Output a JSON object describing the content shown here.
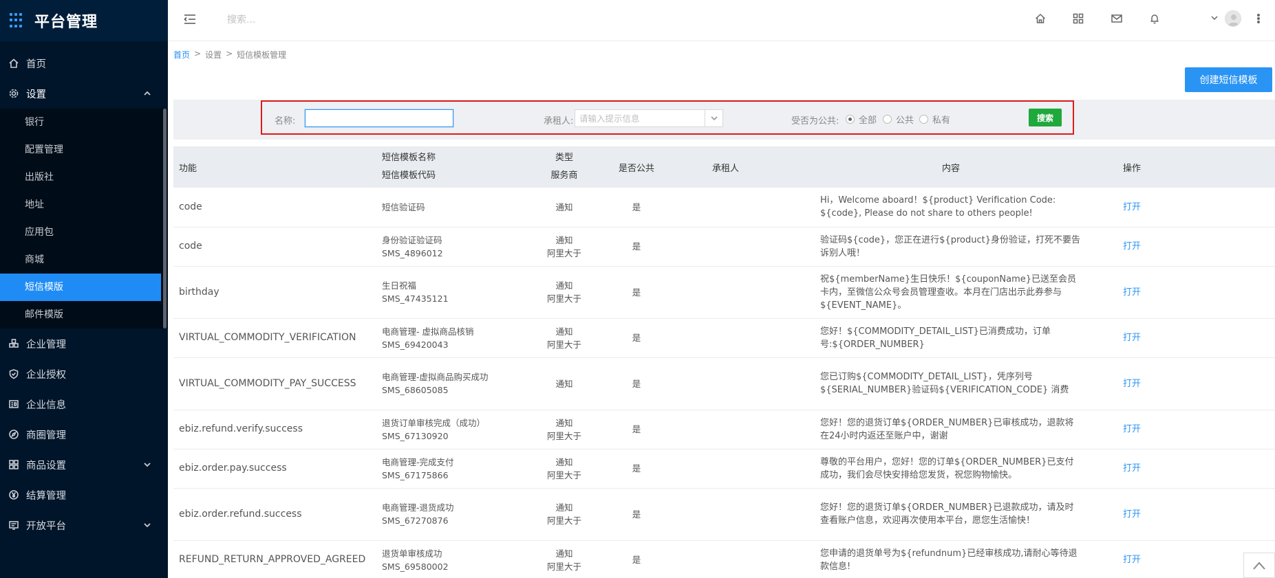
{
  "sidebar": {
    "title": "平台管理",
    "menu": [
      {
        "label": "首页",
        "icon": "home-icon"
      },
      {
        "label": "设置",
        "icon": "gear-icon"
      }
    ],
    "settings_sub": [
      "银行",
      "配置管理",
      "出版社",
      "地址",
      "应用包",
      "商城",
      "短信模版",
      "邮件模版"
    ],
    "active_sub": "短信模版",
    "menu_bottom": [
      {
        "label": "企业管理",
        "icon": "blocks-icon"
      },
      {
        "label": "企业授权",
        "icon": "shield-icon"
      },
      {
        "label": "企业信息",
        "icon": "card-icon"
      },
      {
        "label": "商圈管理",
        "icon": "compass-icon"
      },
      {
        "label": "商品设置",
        "icon": "grid-icon"
      },
      {
        "label": "结算管理",
        "icon": "yen-icon"
      },
      {
        "label": "开放平台",
        "icon": "monitor-icon"
      }
    ]
  },
  "header": {
    "search_placeholder": "搜索..."
  },
  "breadcrumb": {
    "home": "首页",
    "sep": ">",
    "level1": "设置",
    "level2": "短信模板管理"
  },
  "toolbar": {
    "create_label": "创建短信模板"
  },
  "filter": {
    "name_label": "名称:",
    "tenant_label": "承租人:",
    "tenant_placeholder": "请输入提示信息",
    "public_label": "受否为公共:",
    "radio_all": "全部",
    "radio_public": "公共",
    "radio_private": "私有",
    "search_label": "搜索"
  },
  "table": {
    "headers": {
      "func": "功能",
      "name_1": "短信模板名称",
      "name_2": "短信模板代码",
      "type_1": "类型",
      "type_2": "服务商",
      "public": "是否公共",
      "tenant": "承租人",
      "content": "内容",
      "op": "操作"
    },
    "rows": [
      {
        "func": "code",
        "name": "短信验证码",
        "code": "",
        "type": "通知",
        "provider": "",
        "public": "是",
        "content": "Hi，Welcome aboard！${product} Verification Code: ${code}, Please do not share to others people!",
        "op": "打开"
      },
      {
        "func": "code",
        "name": "身份验证验证码",
        "code": "SMS_4896012",
        "type": "通知",
        "provider": "阿里大于",
        "public": "是",
        "content": "验证码${code}，您正在进行${product}身份验证，打死不要告诉别人哦！",
        "op": "打开"
      },
      {
        "func": "birthday",
        "name": "生日祝福",
        "code": "SMS_47435121",
        "type": "通知",
        "provider": "阿里大于",
        "public": "是",
        "content": "祝${memberName}生日快乐！${couponName}已送至会员卡内，至微信公众号会员管理查收。本月在门店出示此券参与${EVENT_NAME}。",
        "op": "打开"
      },
      {
        "func": "VIRTUAL_COMMODITY_VERIFICATION",
        "name": "电商管理- 虚拟商品核销",
        "code": "SMS_69420043",
        "type": "通知",
        "provider": "阿里大于",
        "public": "是",
        "content": "您好！${COMMODITY_DETAIL_LIST}已消费成功，订单号:${ORDER_NUMBER}",
        "op": "打开"
      },
      {
        "func": "VIRTUAL_COMMODITY_PAY_SUCCESS",
        "name": "电商管理-虚拟商品购买成功",
        "code": "SMS_68605085",
        "type": "通知",
        "provider": "",
        "public": "是",
        "content": "您已订购${COMMODITY_DETAIL_LIST}，凭序列号${SERIAL_NUMBER}验证码${VERIFICATION_CODE} 消费",
        "op": "打开"
      },
      {
        "func": "ebiz.refund.verify.success",
        "name": "退货订单审核完成（成功）",
        "code": "SMS_67130920",
        "type": "通知",
        "provider": "阿里大于",
        "public": "是",
        "content": "您好！您的退货订单${ORDER_NUMBER}已审核成功，退款将在24小时内返还至账户中，谢谢",
        "op": "打开"
      },
      {
        "func": "ebiz.order.pay.success",
        "name": "电商管理-完成支付",
        "code": "SMS_67175866",
        "type": "通知",
        "provider": "阿里大于",
        "public": "是",
        "content": "尊敬的平台用户，您好！您的订单${ORDER_NUMBER}已支付成功，我们会尽快安排给您发货，祝您购物愉快。",
        "op": "打开"
      },
      {
        "func": "ebiz.order.refund.success",
        "name": "电商管理-退货成功",
        "code": "SMS_67270876",
        "type": "通知",
        "provider": "阿里大于",
        "public": "是",
        "content": "您好！您的退货订单${ORDER_NUMBER}已退款成功，请及时查看账户信息，欢迎再次使用本平台，愿您生活愉快！",
        "op": "打开"
      },
      {
        "func": "REFUND_RETURN_APPROVED_AGREED",
        "name": "退货单审核成功",
        "code": "SMS_69580002",
        "type": "通知",
        "provider": "阿里大于",
        "public": "是",
        "content": "您申请的退货单号为${refundnum}已经审核成功,请耐心等待退款信息!",
        "op": "打开"
      }
    ]
  }
}
